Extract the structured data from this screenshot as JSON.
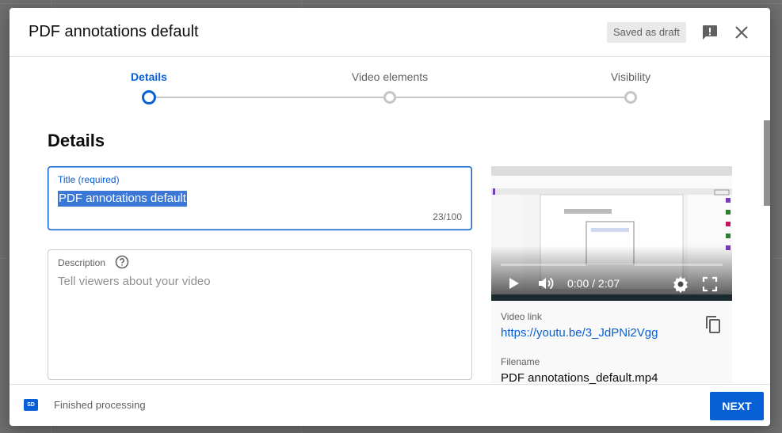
{
  "header": {
    "title": "PDF annotations default",
    "saved_status": "Saved as draft"
  },
  "stepper": {
    "steps": [
      {
        "label": "Details",
        "active": true
      },
      {
        "label": "Video elements",
        "active": false
      },
      {
        "label": "Visibility",
        "active": false
      }
    ]
  },
  "details": {
    "heading": "Details",
    "title_field": {
      "label": "Title (required)",
      "value": "PDF annotations default",
      "counter": "23/100"
    },
    "description_field": {
      "label": "Description",
      "placeholder": "Tell viewers about your video"
    }
  },
  "video": {
    "time": "0:00 / 2:07",
    "link_label": "Video link",
    "link": "https://youtu.be/3_JdPNi2Vgg",
    "filename_label": "Filename",
    "filename": "PDF annotations_default.mp4"
  },
  "footer": {
    "badge": "SD",
    "status": "Finished processing",
    "next_label": "NEXT"
  },
  "colors": {
    "accent": "#065fd4",
    "muted": "#606060"
  },
  "icons": [
    "feedback-icon",
    "close-icon",
    "help-icon",
    "play-icon",
    "volume-icon",
    "settings-icon",
    "fullscreen-icon",
    "copy-icon"
  ]
}
